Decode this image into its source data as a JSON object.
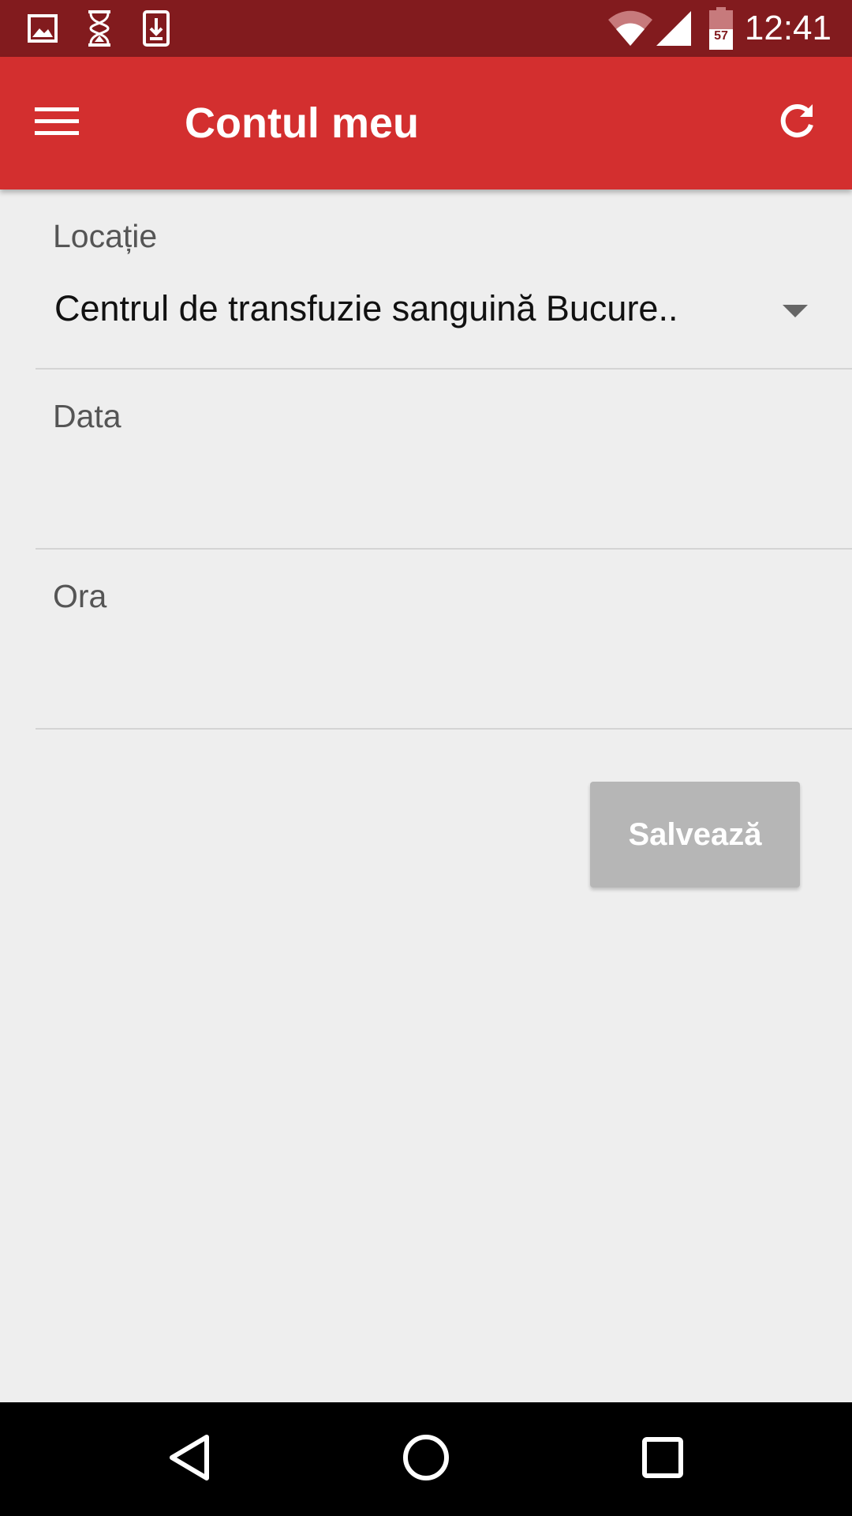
{
  "status_bar": {
    "time": "12:41",
    "battery_level": "57",
    "notification_icons": [
      "image-icon",
      "hourglass-icon",
      "download-icon"
    ],
    "system_icons": [
      "wifi-icon",
      "signal-icon",
      "battery-icon"
    ]
  },
  "app_bar": {
    "title": "Contul meu",
    "menu_icon": "hamburger-icon",
    "refresh_icon": "refresh-icon",
    "background": "#d32f2f"
  },
  "form": {
    "location": {
      "label": "Locație",
      "value": "Centrul de transfuzie sanguină Bucure.."
    },
    "date": {
      "label": "Data",
      "value": ""
    },
    "time": {
      "label": "Ora",
      "value": ""
    },
    "save_label": "Salvează",
    "save_enabled": false
  },
  "nav_bar": {
    "back_icon": "back-triangle-icon",
    "home_icon": "home-circle-icon",
    "recents_icon": "recents-square-icon"
  }
}
